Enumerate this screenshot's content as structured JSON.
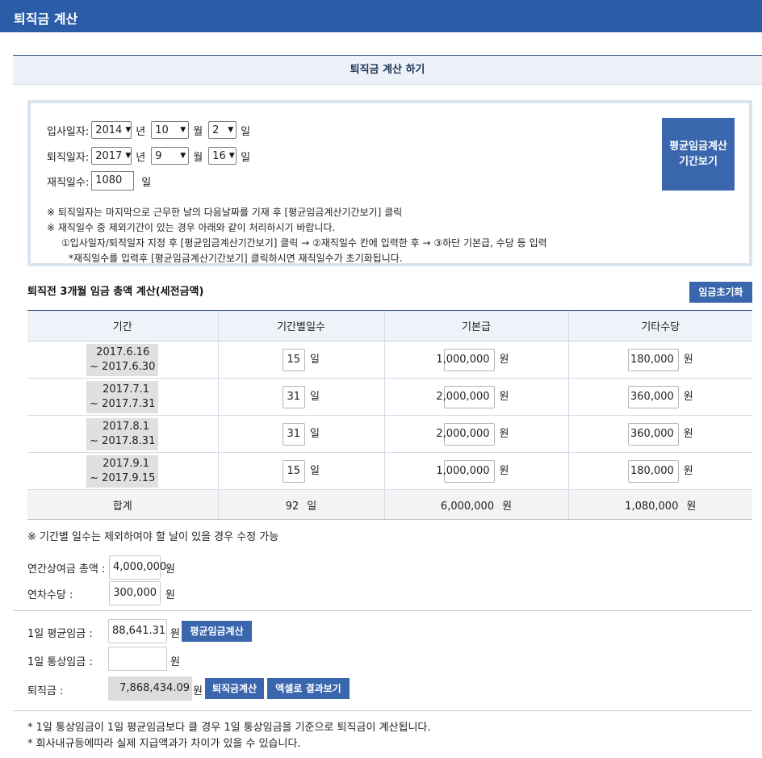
{
  "header": {
    "title": "퇴직금 계산"
  },
  "section": {
    "title": "퇴직금 계산 하기"
  },
  "form": {
    "hire_label": "입사일자:",
    "hire": {
      "year": "2014",
      "month": "10",
      "day": "2"
    },
    "leave_label": "퇴직일자:",
    "leave": {
      "year": "2017",
      "month": "9",
      "day": "16"
    },
    "unit_year": "년",
    "unit_month": "월",
    "unit_day": "일",
    "days_label": "재직일수:",
    "days_value": "1080",
    "days_unit": "일",
    "period_button": [
      "평균임금계산",
      "기간보기"
    ],
    "notes": [
      "※ 퇴직일자는 마지막으로 근무한 날의 다음날짜를 기재 후 [평균임금계산기간보기] 클릭",
      "※ 재직일수 중 제외기간이 있는 경우 아래와 같이 처리하시기 바랍니다.",
      "①입사일자/퇴직일자 지정 후 [평균임금계산기간보기] 클릭 → ②재직일수 칸에 입력한 후 → ③하단 기본급, 수당 등 입력",
      "*재직일수를 입력후 [평균임금계산기간보기] 클릭하시면 재직일수가 초기화됩니다."
    ]
  },
  "wage_section": {
    "title": "퇴직전 3개월 임금 총액 계산(세전금액)",
    "reset_button": "임금초기화",
    "columns": [
      "기간",
      "기간별일수",
      "기본급",
      "기타수당"
    ],
    "day_unit": "일",
    "won_unit": "원",
    "rows": [
      {
        "start": "2017.6.16",
        "end": "~ 2017.6.30",
        "days": "15",
        "base": "1,000,000",
        "extra": "180,000"
      },
      {
        "start": "2017.7.1",
        "end": "~ 2017.7.31",
        "days": "31",
        "base": "2,000,000",
        "extra": "360,000"
      },
      {
        "start": "2017.8.1",
        "end": "~ 2017.8.31",
        "days": "31",
        "base": "2,000,000",
        "extra": "360,000"
      },
      {
        "start": "2017.9.1",
        "end": "~ 2017.9.15",
        "days": "15",
        "base": "1,000,000",
        "extra": "180,000"
      }
    ],
    "total": {
      "label": "합계",
      "days": "92",
      "base": "6,000,000",
      "extra": "1,080,000"
    },
    "note": "※ 기간별 일수는 제외하여야 할 날이 있을 경우 수정 가능"
  },
  "bonus": {
    "annual_label": "연간상여금 총액 :",
    "annual_value": "4,000,000",
    "leave_allowance_label": "연차수당 :",
    "leave_allowance_value": "300,000",
    "unit": "원"
  },
  "result": {
    "avg_label": "1일 평균임금 :",
    "avg_value": "88,641.31",
    "avg_button": "평균임금계산",
    "ordinary_label": "1일 통상임금 :",
    "ordinary_value": "",
    "severance_label": "퇴직금 :",
    "severance_value": "7,868,434.09",
    "severance_button": "퇴직금계산",
    "excel_button": "엑셀로 결과보기",
    "unit": "원"
  },
  "footer_notes": [
    "* 1일 통상임금이 1일 평균임금보다 클 경우 1일 통상임금을 기준으로 퇴직금이 계산됩니다.",
    "* 회사내규등에따라 실제 지급액과가 차이가 있을 수 있습니다."
  ]
}
